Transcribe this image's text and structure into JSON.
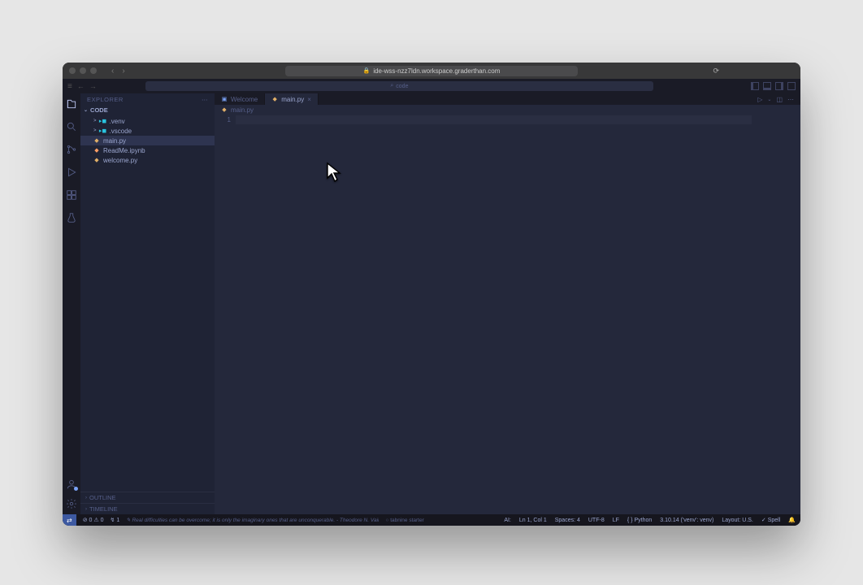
{
  "browser": {
    "url": "ide-wss-nzz7ldn.workspace.graderthan.com"
  },
  "toolbar": {
    "search_placeholder": "code"
  },
  "sidebar": {
    "title": "EXPLORER",
    "root": "CODE",
    "items": [
      {
        "name": ".venv",
        "icon": "folder",
        "chevron": ">"
      },
      {
        "name": ".vscode",
        "icon": "folder",
        "chevron": ">"
      },
      {
        "name": "main.py",
        "icon": "py"
      },
      {
        "name": "ReadMe.ipynb",
        "icon": "nb"
      },
      {
        "name": "welcome.py",
        "icon": "py"
      }
    ],
    "outline": "OUTLINE",
    "timeline": "TIMELINE"
  },
  "tabs": [
    {
      "label": "Welcome",
      "icon": "▢",
      "active": false
    },
    {
      "label": "main.py",
      "icon": "py",
      "active": true
    }
  ],
  "breadcrumb": {
    "file": "main.py"
  },
  "editor": {
    "line": "1"
  },
  "status": {
    "errors": "0",
    "warnings": "0",
    "ports": "1",
    "quote": "Real difficulties can be overcome; it is only the imaginary ones that are unconquerable. - Theodore N. Vail",
    "tabnine": "tabnine starter",
    "ai": "AI:",
    "lncol": "Ln 1, Col 1",
    "spaces": "Spaces: 4",
    "encoding": "UTF-8",
    "eol": "LF",
    "lang": "{ } Python",
    "interpreter": "3.10.14 ('venv': venv)",
    "layout": "Layout: U.S.",
    "spell": "Spell"
  }
}
